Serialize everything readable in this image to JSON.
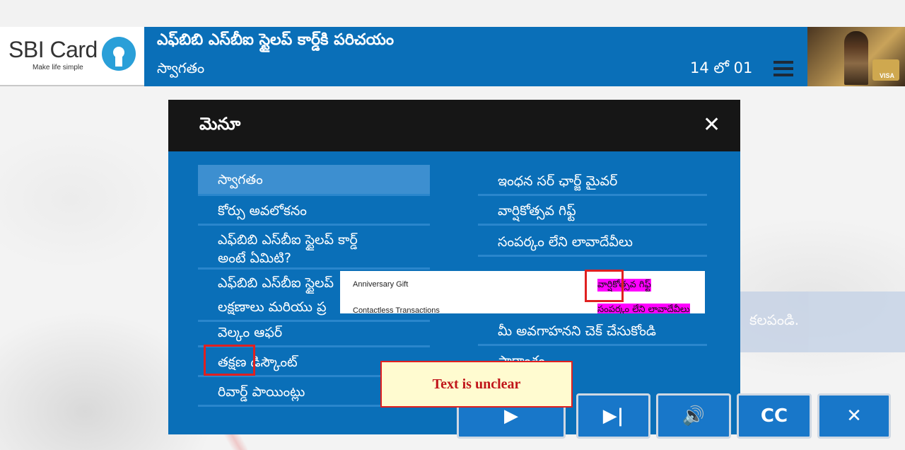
{
  "header": {
    "logo_text": "SBI Card",
    "logo_tagline": "Make life simple",
    "course_title": "ఎఫ్‌బిబి ఎస్‌బీఐ స్టైలప్ కార్డ్‌కి పరిచయం",
    "slide_title": "స్వాగతం",
    "page_counter": "14 లో 01",
    "thumbnail_label": "VISA"
  },
  "menu": {
    "title": "మెనూ",
    "close_label": "✕",
    "left_items": [
      "స్వాగతం",
      "కోర్సు అవలోకనం",
      "ఎఫ్‌బిబి ఎస్‌బీఐ స్టైలప్ కార్డ్ అంటే ఏమిటి?",
      "ఎఫ్‌బిబి ఎస్‌బీఐ స్టైలప్",
      "లక్షణాలు మరియు ప్ర",
      "వెల్కం ఆఫర్",
      "తక్షణ డిస్కౌంట్",
      "రివార్డ్ పాయింట్లు"
    ],
    "right_items": [
      "ఇంధన సర్ ఛార్జ్ మైవర్",
      "వార్షికోత్సవ గిఫ్ట్",
      "సంపర్కం లేని లావాదేవీలు",
      "మీ అవగాహనని చెక్ చేసుకోండి",
      "సారాంశం"
    ]
  },
  "overlay": {
    "line1": "Anniversary Gift",
    "line2": "Contactless Transactions",
    "hl1": "వార్షికోత్సవ గిఫ్ట్",
    "hl2": "సంపర్కం లేని లావాదేవీలు",
    "highlight_color": "#ff00ff"
  },
  "annotation": {
    "unclear_label": "Text is unclear"
  },
  "background": {
    "strip_text": "కలపండి."
  },
  "controls": {
    "play_icon": "play-icon",
    "next_icon": "skip-next-icon",
    "audio_icon": "speaker-icon",
    "cc_label": "CC",
    "exit_icon": "close-icon"
  },
  "colors": {
    "primary_blue": "#0a6fb8",
    "menu_header": "#161616",
    "active_item": "#3d8fd0",
    "alert_red": "#e02020"
  }
}
